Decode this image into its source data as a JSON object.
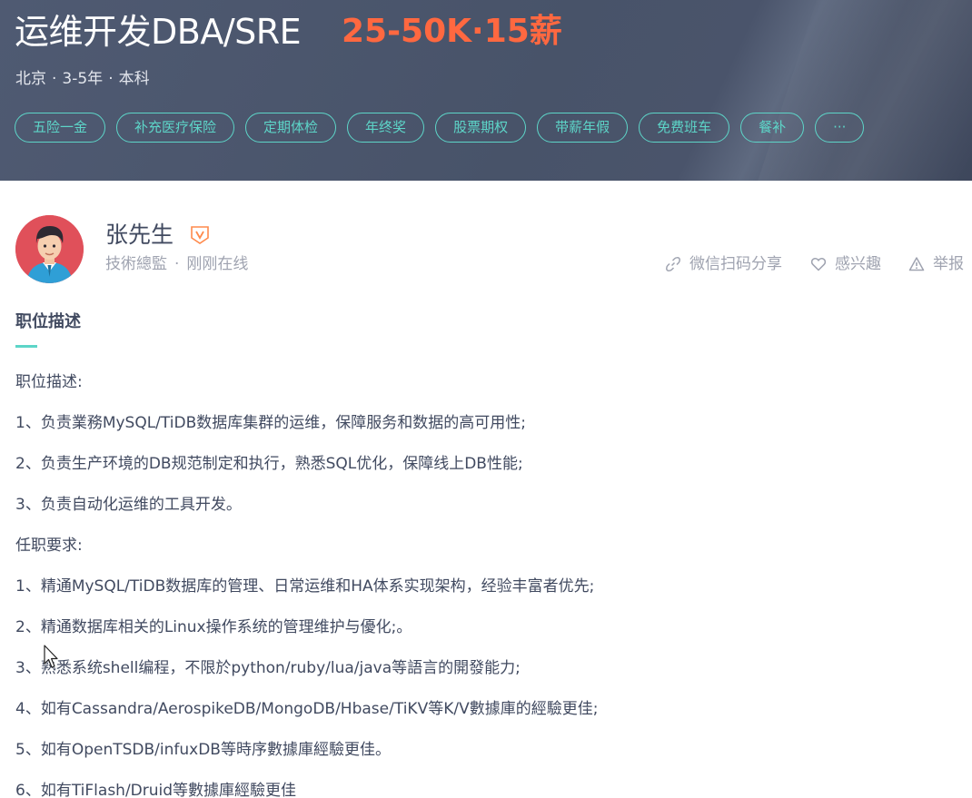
{
  "job": {
    "title": "运维开发DBA/SRE",
    "salary": "25-50K·15薪",
    "city": "北京",
    "experience": "3-5年",
    "degree": "本科",
    "separator": "·",
    "benefits": [
      "五险一金",
      "补充医疗保险",
      "定期体检",
      "年终奖",
      "股票期权",
      "带薪年假",
      "免费班车",
      "餐补",
      "···"
    ]
  },
  "boss": {
    "name": "张先生",
    "title": "技術總監",
    "status": "刚刚在线",
    "separator": "·"
  },
  "actions": {
    "share": "微信扫码分享",
    "interest": "感兴趣",
    "report": "举报"
  },
  "description": {
    "section_title": "职位描述",
    "lines": [
      "职位描述:",
      "1、负责業務MySQL/TiDB数据库集群的运维，保障服务和数据的高可用性;",
      "2、负责生产环境的DB规范制定和执行，熟悉SQL优化，保障线上DB性能;",
      "3、负责自动化运维的工具开发。",
      "任职要求:",
      "1、精通MySQL/TiDB数据库的管理、日常运维和HA体系实现架构，经验丰富者优先;",
      "2、精通数据库相关的Linux操作系统的管理维护与優化;。",
      "3、熟悉系统shell编程，不限於python/ruby/lua/java等語言的開發能力;",
      "4、如有Cassandra/AerospikeDB/MongoDB/Hbase/TiKV等K/V數據庫的經驗更佳;",
      "5、如有OpenTSDB/infuxDB等時序數據庫經驗更佳。",
      "6、如有TiFlash/Druid等數據庫經驗更佳"
    ]
  },
  "colors": {
    "header_bg": "#4a546b",
    "salary": "#ff6840",
    "tag_accent": "#5dd5c8",
    "text": "#414a60",
    "muted": "#9fa3b0",
    "verified_badge": "#ff8a4c"
  }
}
